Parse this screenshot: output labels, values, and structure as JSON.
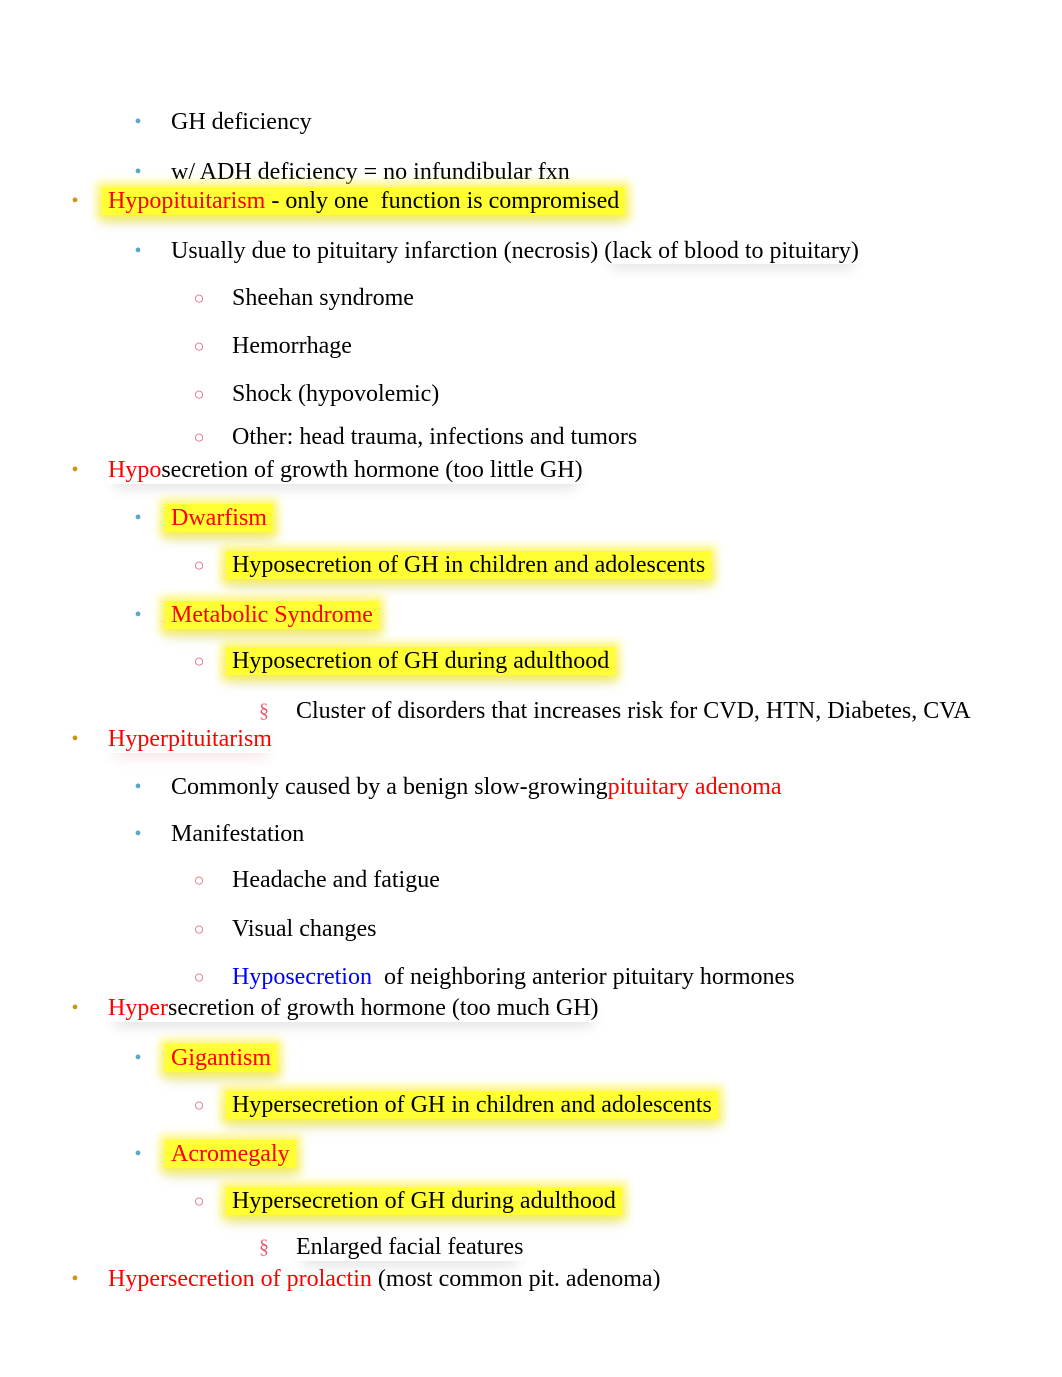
{
  "document": {
    "lines": [
      {
        "level": 2,
        "bullet": "•",
        "segments": [
          {
            "text": "GH deficiency",
            "color": "#000000"
          }
        ]
      },
      {
        "level": 2,
        "bullet": "•",
        "segments": [
          {
            "text": "w/ ADH deficiency = no infundibular fxn",
            "color": "#000000"
          }
        ]
      },
      {
        "level": 1,
        "bullet": "•",
        "highlight": true,
        "segments": [
          {
            "text": "Hypopituitarism",
            "color": "#ff0000"
          },
          {
            "text": " - only one  function is compromised",
            "color": "#000000"
          }
        ]
      },
      {
        "level": 2,
        "bullet": "•",
        "segments": [
          {
            "text": "Usually due to pituitary infarction (necrosis) ",
            "color": "#000000"
          },
          {
            "text": "(lack of blood to pituitary)",
            "color": "#000000",
            "shadow": true
          }
        ]
      },
      {
        "level": 3,
        "bullet": "○",
        "segments": [
          {
            "text": "Sheehan syndrome",
            "color": "#000000"
          }
        ]
      },
      {
        "level": 3,
        "bullet": "○",
        "segments": [
          {
            "text": "Hemorrhage",
            "color": "#000000"
          }
        ]
      },
      {
        "level": 3,
        "bullet": "○",
        "segments": [
          {
            "text": "Shock (hypovolemic)",
            "color": "#000000"
          }
        ]
      },
      {
        "level": 3,
        "bullet": "○",
        "segments": [
          {
            "text": "Other: head trauma, infections and tumors",
            "color": "#000000"
          }
        ]
      },
      {
        "level": 1,
        "bullet": "•",
        "shadow": true,
        "segments": [
          {
            "text": "Hypo",
            "color": "#ff0000"
          },
          {
            "text": "secretion of growth hormone (too little GH)",
            "color": "#000000"
          }
        ]
      },
      {
        "level": 2,
        "bullet": "•",
        "highlight": true,
        "segments": [
          {
            "text": "Dwarfism",
            "color": "#ff0000"
          }
        ]
      },
      {
        "level": 3,
        "bullet": "○",
        "highlight": true,
        "segments": [
          {
            "text": "Hyposecretion of GH in children and adolescents",
            "color": "#000000"
          }
        ]
      },
      {
        "level": 2,
        "bullet": "•",
        "highlight": true,
        "segments": [
          {
            "text": "Metabolic Syndrome",
            "color": "#ff0000"
          }
        ]
      },
      {
        "level": 3,
        "bullet": "○",
        "highlight": true,
        "segments": [
          {
            "text": "Hyposecretion of GH during adulthood",
            "color": "#000000"
          }
        ]
      },
      {
        "level": 4,
        "bullet": "§",
        "segments": [
          {
            "text": "Cluster of disorders that increases risk for CVD, HTN, Diabetes, CVA",
            "color": "#000000"
          }
        ]
      },
      {
        "level": 1,
        "bullet": "•",
        "shadow_red": true,
        "segments": [
          {
            "text": "Hyperpituitarism",
            "color": "#ff0000"
          }
        ]
      },
      {
        "level": 2,
        "bullet": "•",
        "segments": [
          {
            "text": "Commonly caused by a benign slow-growing",
            "color": "#000000"
          },
          {
            "text": "pituitary adenoma",
            "color": "#ff0000"
          }
        ]
      },
      {
        "level": 2,
        "bullet": "•",
        "segments": [
          {
            "text": "Manifestation",
            "color": "#000000"
          }
        ]
      },
      {
        "level": 3,
        "bullet": "○",
        "segments": [
          {
            "text": "Headache and fatigue",
            "color": "#000000"
          }
        ]
      },
      {
        "level": 3,
        "bullet": "○",
        "segments": [
          {
            "text": "Visual changes",
            "color": "#000000"
          }
        ]
      },
      {
        "level": 3,
        "bullet": "○",
        "segments": [
          {
            "text": "Hyposecretion",
            "color": "#0000ff"
          },
          {
            "text": "  of neighboring anterior pituitary hormones",
            "color": "#000000"
          }
        ]
      },
      {
        "level": 1,
        "bullet": "•",
        "shadow": true,
        "segments": [
          {
            "text": "Hyper",
            "color": "#ff0000"
          },
          {
            "text": "secretion of growth hormone (too much GH)",
            "color": "#000000"
          }
        ]
      },
      {
        "level": 2,
        "bullet": "•",
        "highlight": true,
        "segments": [
          {
            "text": "Gigantism",
            "color": "#ff0000"
          }
        ]
      },
      {
        "level": 3,
        "bullet": "○",
        "highlight": true,
        "segments": [
          {
            "text": "Hypersecretion of GH in children and adolescents",
            "color": "#000000"
          }
        ]
      },
      {
        "level": 2,
        "bullet": "•",
        "highlight": true,
        "segments": [
          {
            "text": "Acromegaly",
            "color": "#ff0000"
          }
        ]
      },
      {
        "level": 3,
        "bullet": "○",
        "highlight": true,
        "segments": [
          {
            "text": "Hypersecretion of GH during adulthood",
            "color": "#000000"
          }
        ]
      },
      {
        "level": 4,
        "bullet": "§",
        "shadow": true,
        "segments": [
          {
            "text": "Enlarged facial features",
            "color": "#000000"
          }
        ]
      },
      {
        "level": 1,
        "bullet": "•",
        "segments": [
          {
            "text": "Hypersecretion of prolactin",
            "color": "#ff0000"
          },
          {
            "text": " (most common pit. adenoma)",
            "color": "#000000"
          }
        ]
      }
    ]
  },
  "colors": {
    "bullet_level1": "#d4900f",
    "bullet_level2": "#5aa6c8",
    "bullet_level3": "#e06070",
    "highlight": "#ffff33",
    "accent_red": "#ff0000",
    "accent_blue": "#0000ff"
  }
}
